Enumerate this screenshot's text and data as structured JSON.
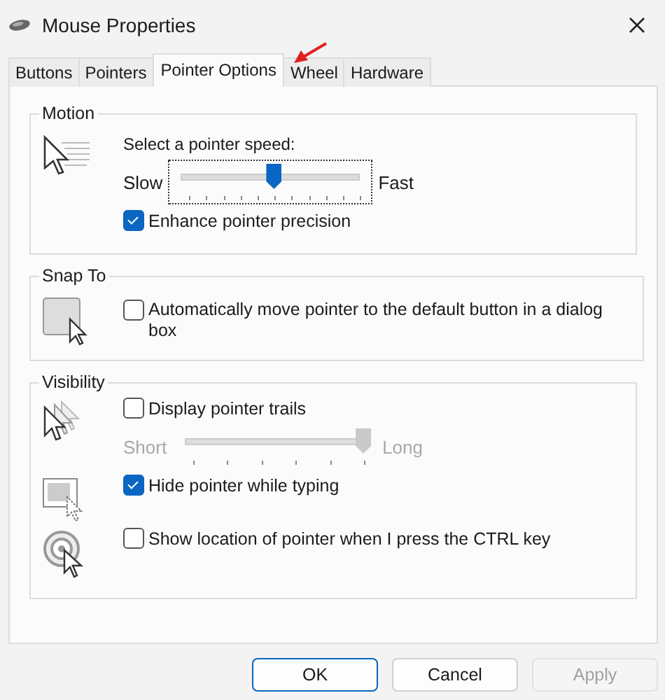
{
  "window": {
    "title": "Mouse Properties"
  },
  "tabs": [
    {
      "label": "Buttons",
      "selected": false
    },
    {
      "label": "Pointers",
      "selected": false
    },
    {
      "label": "Pointer Options",
      "selected": true
    },
    {
      "label": "Wheel",
      "selected": false
    },
    {
      "label": "Hardware",
      "selected": false
    }
  ],
  "motion": {
    "title": "Motion",
    "speed_label": "Select a pointer speed:",
    "min_label": "Slow",
    "max_label": "Fast",
    "speed": {
      "level": 0.5
    },
    "enhance": {
      "label": "Enhance pointer precision",
      "checked": true
    }
  },
  "snap_to": {
    "title": "Snap To",
    "option": {
      "label": "Automatically move pointer to the default button in a dialog box",
      "checked": false
    }
  },
  "visibility": {
    "title": "Visibility",
    "trails": {
      "label": "Display pointer trails",
      "checked": false,
      "min_label": "Short",
      "max_label": "Long",
      "level": 1
    },
    "hide": {
      "label": "Hide pointer while typing",
      "checked": true
    },
    "ctrl": {
      "label": "Show location of pointer when I press the CTRL key",
      "checked": false
    }
  },
  "buttons": [
    {
      "label": "OK",
      "default": true,
      "disabled": false
    },
    {
      "label": "Cancel",
      "default": false,
      "disabled": false
    },
    {
      "label": "Apply",
      "default": false,
      "disabled": true
    }
  ]
}
